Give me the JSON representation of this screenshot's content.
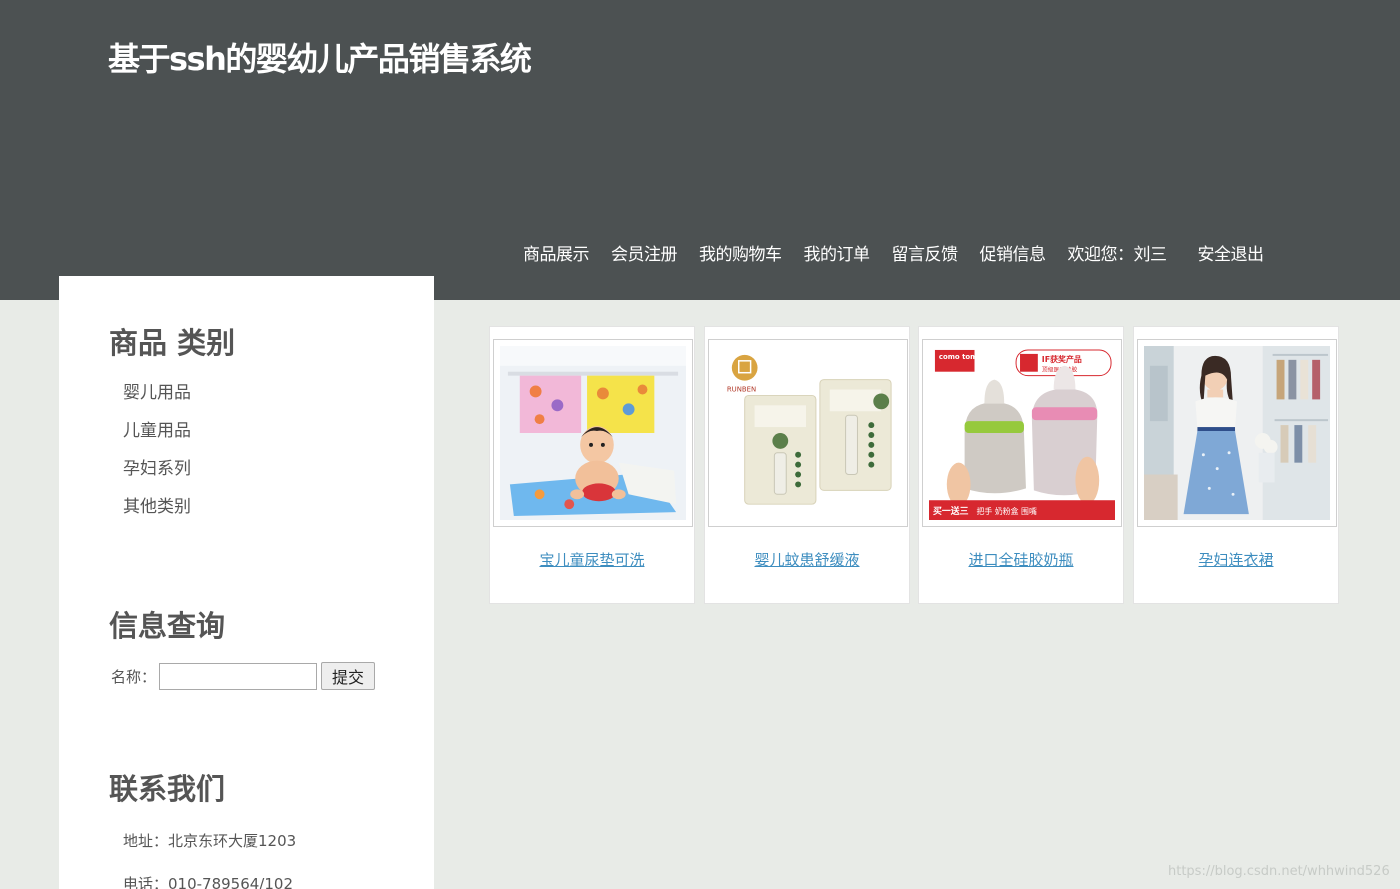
{
  "header": {
    "site_title": "基于ssh的婴幼儿产品销售系统"
  },
  "nav": {
    "items": [
      "商品展示",
      "会员注册",
      "我的购物车",
      "我的订单",
      "留言反馈",
      "促销信息"
    ],
    "welcome": "欢迎您：刘三",
    "logout": "安全退出"
  },
  "sidebar": {
    "categories_title": "商品 类别",
    "categories": [
      "婴儿用品",
      "儿童用品",
      "孕妇系列",
      "其他类别"
    ],
    "search_title": "信息查询",
    "search_label": "名称：",
    "search_value": "",
    "search_button": "提交",
    "contact_title": "联系我们",
    "address": "地址：北京东环大厦1203",
    "phone": "电话：010-789564/102"
  },
  "products": [
    {
      "name": "宝儿童尿垫可洗"
    },
    {
      "name": "婴儿蚊患舒缓液",
      "brand_text": "RUNBEN"
    },
    {
      "name": "进口全硅胶奶瓶",
      "brand_text": "como tomo",
      "award_text": "IF获奖产品",
      "award_sub": "顶级医用硅胶",
      "promo_text": "买一送三",
      "promo_items": "把手 奶粉盒 围嘴"
    },
    {
      "name": "孕妇连衣裙"
    }
  ],
  "watermark": "https://blog.csdn.net/whhwind526",
  "colors": {
    "header_bg": "#4c5152",
    "page_bg": "#e8ebe7",
    "link": "#3d8dbf"
  }
}
